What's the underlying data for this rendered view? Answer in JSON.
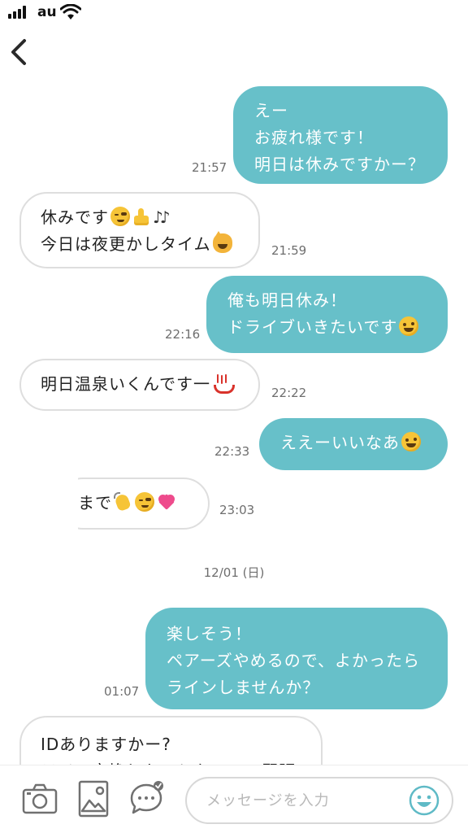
{
  "status_bar": {
    "carrier": "au"
  },
  "messages": [
    {
      "dir": "out",
      "lines": [
        "えー",
        "お疲れ様です！",
        "明日は休みですかー？"
      ],
      "time": "21:57"
    },
    {
      "dir": "in",
      "lines": [
        "休みです",
        "今日は夜更かしタイム"
      ],
      "time": "21:59"
    },
    {
      "dir": "out",
      "lines": [
        "俺も明日休み！",
        "ドライブいきたいです"
      ],
      "time": "22:16"
    },
    {
      "dir": "in",
      "lines": [
        "明日温泉いくんです一"
      ],
      "time": "22:22"
    },
    {
      "dir": "out",
      "lines": [
        "ええーいいなあ"
      ],
      "time": "22:33"
    },
    {
      "dir": "in",
      "lines": [
        "まで"
      ],
      "time": "23:03"
    },
    {
      "dir": "out",
      "lines": [
        "楽しそう！",
        "ペアーズやめるので、よかったら",
        "ラインしませんか？"
      ],
      "time": "01:07"
    },
    {
      "dir": "in",
      "lines": [
        "IDありますかー?",
        "ライン交換したことないので緊張"
      ]
    }
  ],
  "date_separator": "12/01 (日)",
  "input": {
    "placeholder": "メッセージを入力"
  },
  "colors": {
    "outgoing_bubble": "#67c0c9",
    "incoming_border": "#dedede",
    "timestamp": "#6e6e6e"
  },
  "icons": [
    "back-chevron-icon",
    "camera-icon",
    "image-icon",
    "chat-bubble-icon",
    "emoji-smile-icon"
  ]
}
